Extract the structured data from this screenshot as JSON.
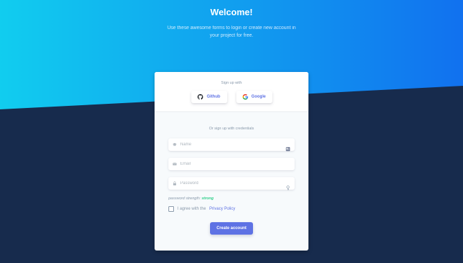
{
  "header": {
    "title": "Welcome!",
    "lead": "Use these awesome forms to login or create new account in your project for free."
  },
  "card": {
    "signup_with": "Sign up with",
    "social": [
      {
        "label": "Github",
        "icon": "github-icon"
      },
      {
        "label": "Google",
        "icon": "google-icon"
      }
    ],
    "credentials_text": "Or sign up with credentials",
    "fields": {
      "name_placeholder": "Name",
      "email_placeholder": "Email",
      "password_placeholder": "Password"
    },
    "strength_label": "password strength:",
    "strength_value": "strong",
    "agree_text": "I agree with the",
    "privacy_link": "Privacy Policy",
    "submit_label": "Create account"
  },
  "colors": {
    "gradient_start": "#11cdef",
    "gradient_end": "#1171ef",
    "background": "#172b4d",
    "primary": "#5e72e4",
    "success": "#2dce89"
  }
}
